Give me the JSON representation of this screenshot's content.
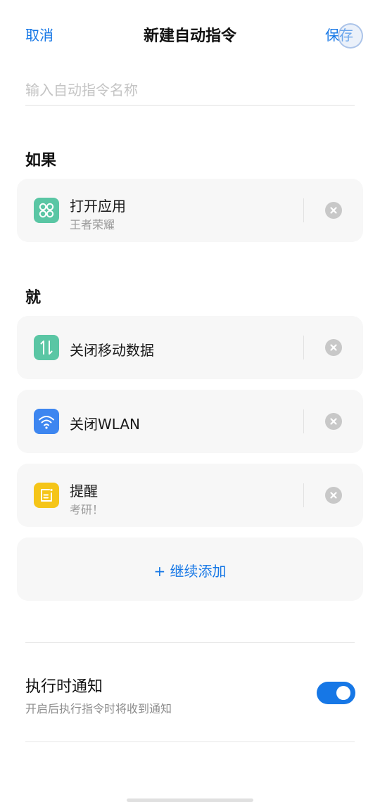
{
  "header": {
    "cancel_label": "取消",
    "title": "新建自动指令",
    "save_label": "保存"
  },
  "name_input": {
    "value": "",
    "placeholder": "输入自动指令名称"
  },
  "condition_section": {
    "label": "如果",
    "cards": [
      {
        "title": "打开应用",
        "subtitle": "王者荣耀",
        "icon": "app-grid-icon",
        "icon_color": "#5ac6a4"
      }
    ]
  },
  "action_section": {
    "label": "就",
    "cards": [
      {
        "title": "关闭移动数据",
        "icon": "mobile-data-icon",
        "icon_color": "#5ac6a4"
      },
      {
        "title": "关闭WLAN",
        "icon": "wifi-icon",
        "icon_color": "#3d86f0"
      },
      {
        "title": "提醒",
        "subtitle": "考研！",
        "icon": "reminder-note-icon",
        "icon_color": "#f5c518"
      }
    ],
    "add_label": "+ 继续添加"
  },
  "notification": {
    "title": "执行时通知",
    "description": "开启后执行指令时将收到通知",
    "enabled": true
  },
  "colors": {
    "accent": "#1677e6",
    "card_background": "#f7f7f7",
    "remove_button": "#c8c8c8"
  }
}
